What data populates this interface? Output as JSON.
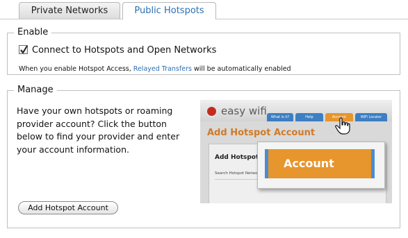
{
  "tabs": {
    "private_label": "Private Networks",
    "public_label": "Public Hotspots"
  },
  "enable": {
    "legend": "Enable",
    "checkbox_label": "Connect to Hotspots and Open Networks",
    "checked": true,
    "note_before": "When you enable Hotspot Access, ",
    "note_link": "Relayed Transfers",
    "note_after": " will be automatically enabled"
  },
  "manage": {
    "legend": "Manage",
    "description": "Have your own hotspots or roaming provider account? Click the button below to find your provider and enter your account information.",
    "button_label": "Add Hotspot Account"
  },
  "preview": {
    "logo_text": "easy wifi",
    "nav": [
      "What is it?",
      "Help",
      "Account",
      "WiFi Locator"
    ],
    "page_title": "Add Hotspot Account",
    "panel_title": "Add Hotspot A",
    "panel_sub": "Search Hotspot Network",
    "zoom_label": "Account"
  },
  "colors": {
    "tab_active_text": "#2c6fb0",
    "link": "#2a6db3",
    "orange": "#e7952d",
    "blue": "#4a8dd1"
  }
}
